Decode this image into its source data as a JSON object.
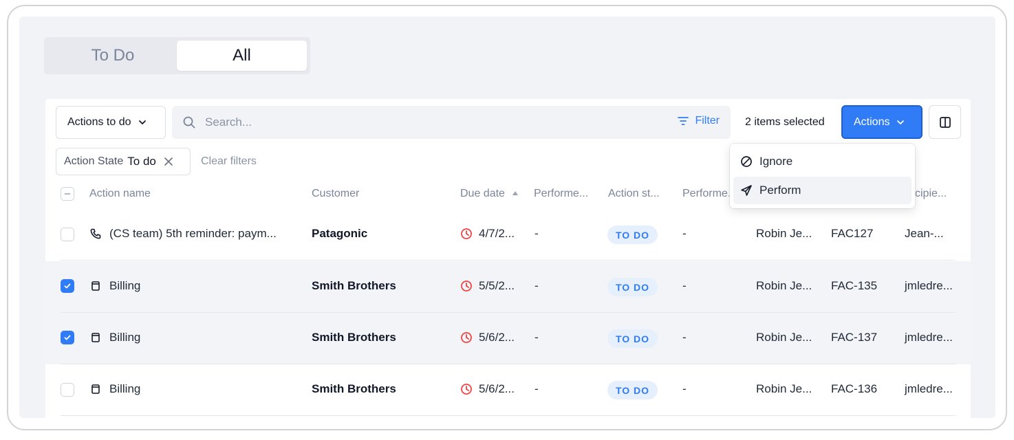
{
  "tabs": [
    {
      "label": "To Do",
      "active": false
    },
    {
      "label": "All",
      "active": true
    }
  ],
  "toolbar": {
    "actions_todo_label": "Actions to do",
    "search_placeholder": "Search...",
    "filter_label": "Filter",
    "selected_count": "2 items selected",
    "actions_label": "Actions"
  },
  "filters": {
    "chip_key": "Action State",
    "chip_value": "To do",
    "clear_label": "Clear filters"
  },
  "columns": [
    "Action name",
    "Customer",
    "Due date",
    "Performe...",
    "Action st...",
    "Performe...",
    "",
    "",
    "cipie..."
  ],
  "rows": [
    {
      "icon": "phone-icon",
      "action": "(CS team) 5th reminder: paym...",
      "customer": "Patagonic",
      "due": "4/7/2...",
      "performed_at": "-",
      "state": "TO DO",
      "performed_by": "-",
      "assignee": "Robin Je...",
      "invoice": "FAC127",
      "recipient": "Jean-...",
      "selected": false
    },
    {
      "icon": "document-icon",
      "action": "Billing",
      "customer": "Smith Brothers",
      "due": "5/5/2...",
      "performed_at": "-",
      "state": "TO DO",
      "performed_by": "-",
      "assignee": "Robin Je...",
      "invoice": "FAC-135",
      "recipient": "jmledre...",
      "selected": true
    },
    {
      "icon": "document-icon",
      "action": "Billing",
      "customer": "Smith Brothers",
      "due": "5/6/2...",
      "performed_at": "-",
      "state": "TO DO",
      "performed_by": "-",
      "assignee": "Robin Je...",
      "invoice": "FAC-137",
      "recipient": "jmledre...",
      "selected": true
    },
    {
      "icon": "document-icon",
      "action": "Billing",
      "customer": "Smith Brothers",
      "due": "5/6/2...",
      "performed_at": "-",
      "state": "TO DO",
      "performed_by": "-",
      "assignee": "Robin Je...",
      "invoice": "FAC-136",
      "recipient": "jmledre...",
      "selected": false
    }
  ],
  "menu": {
    "items": [
      {
        "label": "Ignore",
        "icon": "ban-icon"
      },
      {
        "label": "Perform",
        "icon": "send-icon"
      }
    ]
  },
  "colors": {
    "accent": "#2f7cf6",
    "due_icon": "#ef4444",
    "badge_bg": "#e6effc"
  }
}
